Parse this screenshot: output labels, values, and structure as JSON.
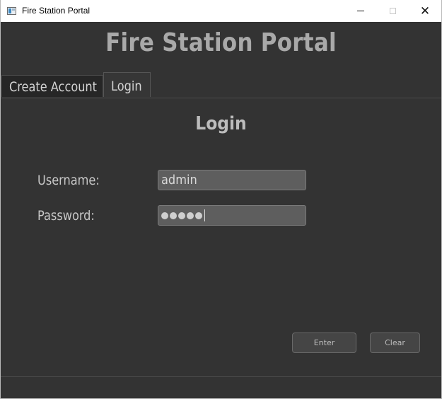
{
  "window": {
    "title": "Fire Station Portal",
    "controls": {
      "minimize": "minimize",
      "maximize": "maximize",
      "close": "✕"
    }
  },
  "header": {
    "title": "Fire Station Portal"
  },
  "tabs": [
    {
      "label": "Create Account",
      "selected": false
    },
    {
      "label": "Login",
      "selected": true
    }
  ],
  "login_form": {
    "title": "Login",
    "username_label": "Username:",
    "username_value": "admin",
    "password_label": "Password:",
    "password_masked_length": 5,
    "enter_label": "Enter",
    "clear_label": "Clear"
  },
  "icons": {
    "app": "app-window-icon",
    "minimize": "minimize-icon",
    "maximize": "maximize-icon",
    "close": "close-icon"
  },
  "colors": {
    "background": "#333333",
    "title_text": "#a9a9a9",
    "field_background": "#5e5e5e",
    "button_background": "#454545"
  }
}
